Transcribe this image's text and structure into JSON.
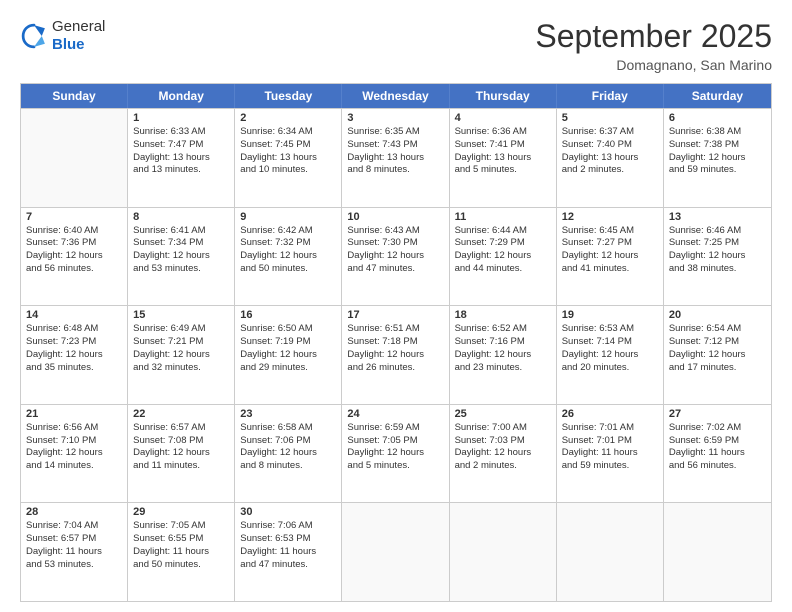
{
  "header": {
    "logo_general": "General",
    "logo_blue": "Blue",
    "month_title": "September 2025",
    "location": "Domagnano, San Marino"
  },
  "weekdays": [
    "Sunday",
    "Monday",
    "Tuesday",
    "Wednesday",
    "Thursday",
    "Friday",
    "Saturday"
  ],
  "rows": [
    [
      {
        "day": "",
        "empty": true
      },
      {
        "day": "1",
        "l1": "Sunrise: 6:33 AM",
        "l2": "Sunset: 7:47 PM",
        "l3": "Daylight: 13 hours",
        "l4": "and 13 minutes."
      },
      {
        "day": "2",
        "l1": "Sunrise: 6:34 AM",
        "l2": "Sunset: 7:45 PM",
        "l3": "Daylight: 13 hours",
        "l4": "and 10 minutes."
      },
      {
        "day": "3",
        "l1": "Sunrise: 6:35 AM",
        "l2": "Sunset: 7:43 PM",
        "l3": "Daylight: 13 hours",
        "l4": "and 8 minutes."
      },
      {
        "day": "4",
        "l1": "Sunrise: 6:36 AM",
        "l2": "Sunset: 7:41 PM",
        "l3": "Daylight: 13 hours",
        "l4": "and 5 minutes."
      },
      {
        "day": "5",
        "l1": "Sunrise: 6:37 AM",
        "l2": "Sunset: 7:40 PM",
        "l3": "Daylight: 13 hours",
        "l4": "and 2 minutes."
      },
      {
        "day": "6",
        "l1": "Sunrise: 6:38 AM",
        "l2": "Sunset: 7:38 PM",
        "l3": "Daylight: 12 hours",
        "l4": "and 59 minutes."
      }
    ],
    [
      {
        "day": "7",
        "l1": "Sunrise: 6:40 AM",
        "l2": "Sunset: 7:36 PM",
        "l3": "Daylight: 12 hours",
        "l4": "and 56 minutes."
      },
      {
        "day": "8",
        "l1": "Sunrise: 6:41 AM",
        "l2": "Sunset: 7:34 PM",
        "l3": "Daylight: 12 hours",
        "l4": "and 53 minutes."
      },
      {
        "day": "9",
        "l1": "Sunrise: 6:42 AM",
        "l2": "Sunset: 7:32 PM",
        "l3": "Daylight: 12 hours",
        "l4": "and 50 minutes."
      },
      {
        "day": "10",
        "l1": "Sunrise: 6:43 AM",
        "l2": "Sunset: 7:30 PM",
        "l3": "Daylight: 12 hours",
        "l4": "and 47 minutes."
      },
      {
        "day": "11",
        "l1": "Sunrise: 6:44 AM",
        "l2": "Sunset: 7:29 PM",
        "l3": "Daylight: 12 hours",
        "l4": "and 44 minutes."
      },
      {
        "day": "12",
        "l1": "Sunrise: 6:45 AM",
        "l2": "Sunset: 7:27 PM",
        "l3": "Daylight: 12 hours",
        "l4": "and 41 minutes."
      },
      {
        "day": "13",
        "l1": "Sunrise: 6:46 AM",
        "l2": "Sunset: 7:25 PM",
        "l3": "Daylight: 12 hours",
        "l4": "and 38 minutes."
      }
    ],
    [
      {
        "day": "14",
        "l1": "Sunrise: 6:48 AM",
        "l2": "Sunset: 7:23 PM",
        "l3": "Daylight: 12 hours",
        "l4": "and 35 minutes."
      },
      {
        "day": "15",
        "l1": "Sunrise: 6:49 AM",
        "l2": "Sunset: 7:21 PM",
        "l3": "Daylight: 12 hours",
        "l4": "and 32 minutes."
      },
      {
        "day": "16",
        "l1": "Sunrise: 6:50 AM",
        "l2": "Sunset: 7:19 PM",
        "l3": "Daylight: 12 hours",
        "l4": "and 29 minutes."
      },
      {
        "day": "17",
        "l1": "Sunrise: 6:51 AM",
        "l2": "Sunset: 7:18 PM",
        "l3": "Daylight: 12 hours",
        "l4": "and 26 minutes."
      },
      {
        "day": "18",
        "l1": "Sunrise: 6:52 AM",
        "l2": "Sunset: 7:16 PM",
        "l3": "Daylight: 12 hours",
        "l4": "and 23 minutes."
      },
      {
        "day": "19",
        "l1": "Sunrise: 6:53 AM",
        "l2": "Sunset: 7:14 PM",
        "l3": "Daylight: 12 hours",
        "l4": "and 20 minutes."
      },
      {
        "day": "20",
        "l1": "Sunrise: 6:54 AM",
        "l2": "Sunset: 7:12 PM",
        "l3": "Daylight: 12 hours",
        "l4": "and 17 minutes."
      }
    ],
    [
      {
        "day": "21",
        "l1": "Sunrise: 6:56 AM",
        "l2": "Sunset: 7:10 PM",
        "l3": "Daylight: 12 hours",
        "l4": "and 14 minutes."
      },
      {
        "day": "22",
        "l1": "Sunrise: 6:57 AM",
        "l2": "Sunset: 7:08 PM",
        "l3": "Daylight: 12 hours",
        "l4": "and 11 minutes."
      },
      {
        "day": "23",
        "l1": "Sunrise: 6:58 AM",
        "l2": "Sunset: 7:06 PM",
        "l3": "Daylight: 12 hours",
        "l4": "and 8 minutes."
      },
      {
        "day": "24",
        "l1": "Sunrise: 6:59 AM",
        "l2": "Sunset: 7:05 PM",
        "l3": "Daylight: 12 hours",
        "l4": "and 5 minutes."
      },
      {
        "day": "25",
        "l1": "Sunrise: 7:00 AM",
        "l2": "Sunset: 7:03 PM",
        "l3": "Daylight: 12 hours",
        "l4": "and 2 minutes."
      },
      {
        "day": "26",
        "l1": "Sunrise: 7:01 AM",
        "l2": "Sunset: 7:01 PM",
        "l3": "Daylight: 11 hours",
        "l4": "and 59 minutes."
      },
      {
        "day": "27",
        "l1": "Sunrise: 7:02 AM",
        "l2": "Sunset: 6:59 PM",
        "l3": "Daylight: 11 hours",
        "l4": "and 56 minutes."
      }
    ],
    [
      {
        "day": "28",
        "l1": "Sunrise: 7:04 AM",
        "l2": "Sunset: 6:57 PM",
        "l3": "Daylight: 11 hours",
        "l4": "and 53 minutes."
      },
      {
        "day": "29",
        "l1": "Sunrise: 7:05 AM",
        "l2": "Sunset: 6:55 PM",
        "l3": "Daylight: 11 hours",
        "l4": "and 50 minutes."
      },
      {
        "day": "30",
        "l1": "Sunrise: 7:06 AM",
        "l2": "Sunset: 6:53 PM",
        "l3": "Daylight: 11 hours",
        "l4": "and 47 minutes."
      },
      {
        "day": "",
        "empty": true
      },
      {
        "day": "",
        "empty": true
      },
      {
        "day": "",
        "empty": true
      },
      {
        "day": "",
        "empty": true
      }
    ]
  ]
}
